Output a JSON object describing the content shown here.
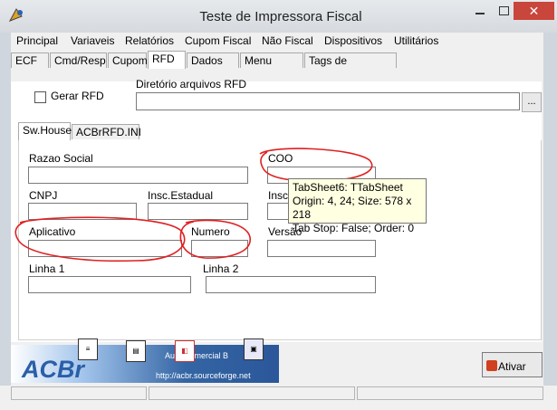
{
  "window": {
    "title": "Teste de Impressora Fiscal",
    "close_glyph": "✕"
  },
  "menu": [
    "Principal",
    "Variaveis",
    "Relatórios",
    "Cupom Fiscal",
    "Não Fiscal",
    "Dispositivos",
    "Utilitários"
  ],
  "tabs": [
    "ECF",
    "Cmd/Resp",
    "Cupom",
    "RFD",
    "Dados RZ",
    "Menu Fiscal",
    "Tags de Impressão"
  ],
  "active_tab": "RFD",
  "rfd": {
    "gerar_rfd_label": "Gerar RFD",
    "gerar_rfd_checked": false,
    "diretorio_label": "Diretório arquivos RFD",
    "diretorio_value": "",
    "browse_label": "..."
  },
  "inner_tabs": [
    "Sw.House",
    "ACBrRFD.INI"
  ],
  "active_inner_tab": "Sw.House",
  "fields": {
    "razao_social": "Razao Social",
    "coo": "COO",
    "cnpj": "CNPJ",
    "insc_estadual": "Insc.Estadual",
    "insc_municipal_partial": "Insc.",
    "aplicativo": "Aplicativo",
    "numero": "Numero",
    "versao": "Versão",
    "linha1": "Linha 1",
    "linha2": "Linha 2"
  },
  "tooltip": {
    "line1": "TabSheet6: TTabSheet",
    "line2": "Origin: 4, 24; Size: 578 x 218",
    "line3": "Tab Stop: False; Order: 0"
  },
  "banner": {
    "logo": "ACBr",
    "tagline": "Auto          Comercial B",
    "url": "http://acbr.sourceforge.net"
  },
  "buttons": {
    "ativar": "Ativar"
  },
  "icons": {
    "app": "printer-icon",
    "ativar": "power-icon"
  }
}
